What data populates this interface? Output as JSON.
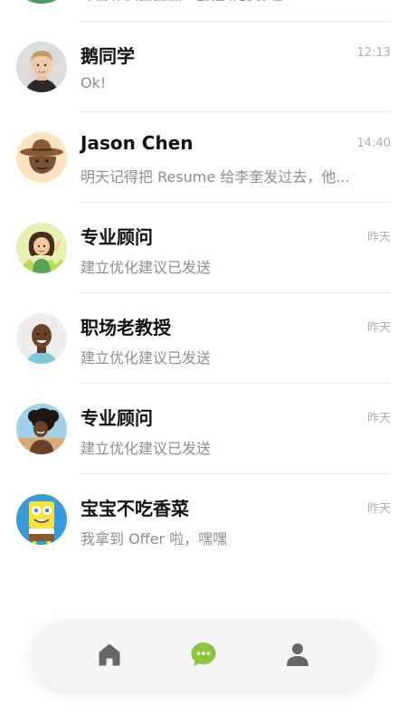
{
  "partial_row": {
    "preview": "还是我们聊聊吧，帮你选择合适"
  },
  "chats": [
    {
      "name": "鹅同学",
      "preview": "Ok!",
      "time": "12:13",
      "avatar_icon": "young-man-avatar"
    },
    {
      "name": "Jason Chen",
      "preview": "明天记得把 Resume 给李奎发过去，他...",
      "time": "14:40",
      "avatar_icon": "cowboy-avatar"
    },
    {
      "name": "专业顾问",
      "preview": "建立优化建议已发送",
      "time": "昨天",
      "avatar_icon": "cartoon-girl-avatar"
    },
    {
      "name": "职场老教授",
      "preview": "建立优化建议已发送",
      "time": "昨天",
      "avatar_icon": "smiling-man-avatar"
    },
    {
      "name": "专业顾问",
      "preview": "建立优化建议已发送",
      "time": "昨天",
      "avatar_icon": "curly-hair-woman-avatar"
    },
    {
      "name": "宝宝不吃香菜",
      "preview": "我拿到 Offer 啦，嘿嘿",
      "time": "昨天",
      "avatar_icon": "spongebob-avatar"
    }
  ],
  "nav": {
    "home_icon": "home-icon",
    "messages_icon": "chat-bubble-icon",
    "profile_icon": "person-icon",
    "active": "messages",
    "active_color": "#8cc63f",
    "inactive_color": "#666666"
  }
}
